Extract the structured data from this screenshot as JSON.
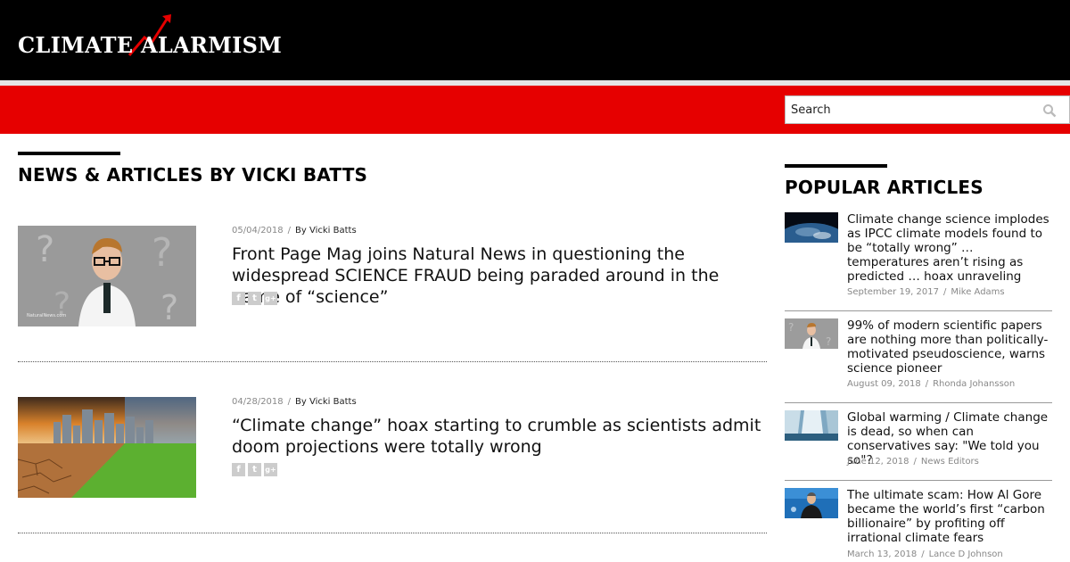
{
  "site": {
    "logo_text": "CLIMATE ALARMISM"
  },
  "search": {
    "placeholder": "Search"
  },
  "main": {
    "heading": "NEWS & ARTICLES BY VICKI BATTS",
    "articles": [
      {
        "date": "05/04/2018",
        "separator": "/",
        "author": "By Vicki Batts",
        "title": "Front Page Mag joins Natural News in questioning the widespread SCIENCE FRAUD being paraded around in the name of “science”",
        "thumb_watermark": "NaturalNews.com"
      },
      {
        "date": "04/28/2018",
        "separator": "/",
        "author": "By Vicki Batts",
        "title": "“Climate change” hoax starting to crumble as scientists admit doom projections were totally wrong"
      }
    ],
    "share_icons": [
      "f",
      "t",
      "g+"
    ]
  },
  "sidebar": {
    "heading": "POPULAR ARTICLES",
    "items": [
      {
        "title": "Climate change science implodes as IPCC climate models found to be “totally wrong” … temperatures aren’t rising as predicted … hoax unraveling",
        "date": "September 19, 2017",
        "separator": "/",
        "author": "Mike Adams"
      },
      {
        "title": "99% of modern scientific papers are nothing more than politically-motivated pseudoscience, warns science pioneer",
        "date": "August 09, 2018",
        "separator": "/",
        "author": "Rhonda Johansson"
      },
      {
        "title": "Global warming / Climate change is dead, so when can conservatives say: \"We told you so\"?",
        "date": "June 12, 2018",
        "separator": "/",
        "author": "News Editors"
      },
      {
        "title": "The ultimate scam: How Al Gore became the world’s first “carbon billionaire” by profiting off irrational climate fears",
        "date": "March 13, 2018",
        "separator": "/",
        "author": "Lance D Johnson"
      }
    ]
  },
  "colors": {
    "header_bg": "#000000",
    "accent_red": "#e60000",
    "meta_gray": "#888888"
  }
}
